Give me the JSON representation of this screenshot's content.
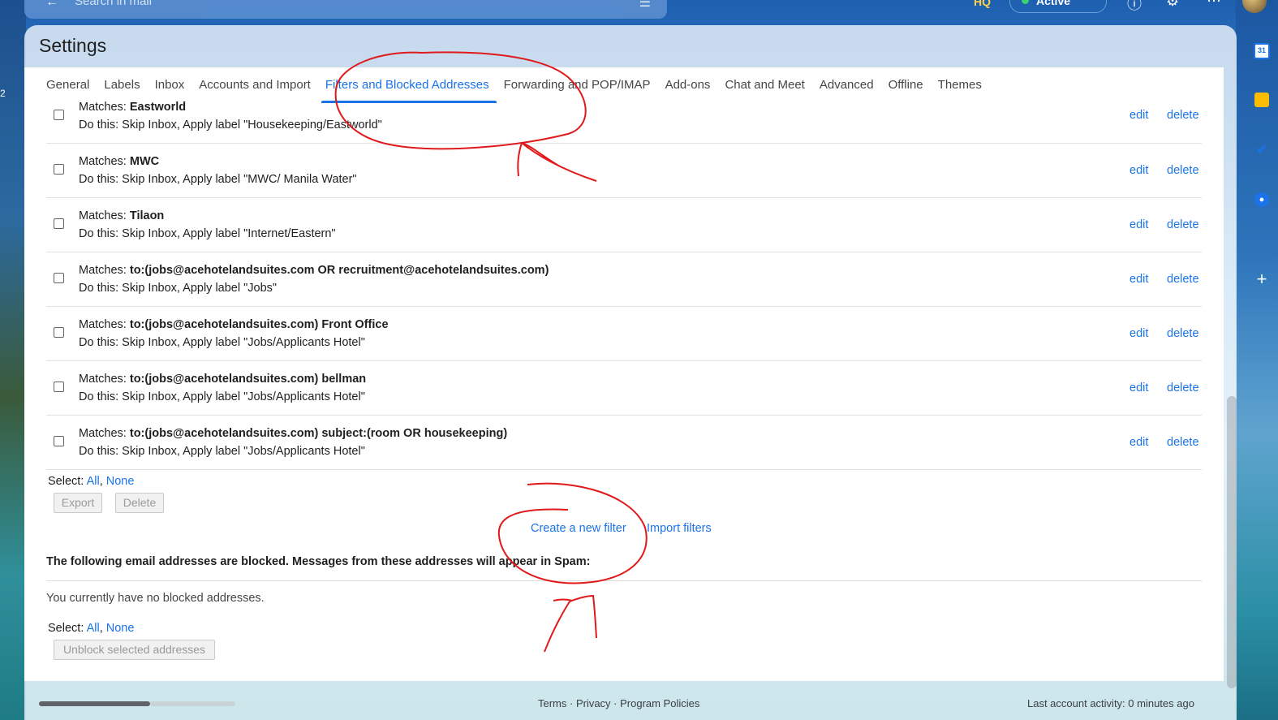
{
  "search": {
    "placeholder": "Search in mail"
  },
  "header": {
    "hq": "HQ",
    "status": "Active"
  },
  "page_title": "Settings",
  "tabs": [
    {
      "label": "General"
    },
    {
      "label": "Labels"
    },
    {
      "label": "Inbox"
    },
    {
      "label": "Accounts and Import"
    },
    {
      "label": "Filters and Blocked Addresses"
    },
    {
      "label": "Forwarding and POP/IMAP"
    },
    {
      "label": "Add-ons"
    },
    {
      "label": "Chat and Meet"
    },
    {
      "label": "Advanced"
    },
    {
      "label": "Offline"
    },
    {
      "label": "Themes"
    }
  ],
  "filters": [
    {
      "match_prefix": "Matches: ",
      "match": "Eastworld",
      "action": "Do this: Skip Inbox, Apply label \"Housekeeping/Eastworld\""
    },
    {
      "match_prefix": "Matches: ",
      "match": "MWC",
      "action": "Do this: Skip Inbox, Apply label \"MWC/ Manila Water\""
    },
    {
      "match_prefix": "Matches: ",
      "match": "Tilaon",
      "action": "Do this: Skip Inbox, Apply label \"Internet/Eastern\""
    },
    {
      "match_prefix": "Matches: ",
      "match": "to:(jobs@acehotelandsuites.com OR recruitment@acehotelandsuites.com)",
      "action": "Do this: Skip Inbox, Apply label \"Jobs\""
    },
    {
      "match_prefix": "Matches: ",
      "match": "to:(jobs@acehotelandsuites.com) Front Office",
      "action": "Do this: Skip Inbox, Apply label \"Jobs/Applicants Hotel\""
    },
    {
      "match_prefix": "Matches: ",
      "match": "to:(jobs@acehotelandsuites.com) bellman",
      "action": "Do this: Skip Inbox, Apply label \"Jobs/Applicants Hotel\""
    },
    {
      "match_prefix": "Matches: ",
      "match": "to:(jobs@acehotelandsuites.com) subject:(room OR housekeeping)",
      "action": "Do this: Skip Inbox, Apply label \"Jobs/Applicants Hotel\""
    }
  ],
  "row_actions": {
    "edit": "edit",
    "delete": "delete"
  },
  "select": {
    "label": "Select:",
    "all": "All",
    "sep": ", ",
    "none": "None"
  },
  "buttons": {
    "export": "Export",
    "delete": "Delete",
    "unblock": "Unblock selected addresses"
  },
  "links": {
    "create_filter": "Create a new filter",
    "import_filters": "Import filters"
  },
  "blocked": {
    "heading": "The following email addresses are blocked. Messages from these addresses will appear in Spam:",
    "empty": "You currently have no blocked addresses."
  },
  "footer": {
    "links": "Terms · Privacy · Program Policies",
    "activity": "Last account activity: 0 minutes ago"
  },
  "rail": {
    "calendar_day": "31"
  },
  "colors": {
    "accent": "#1a73e8",
    "annotation": "#e0191b"
  },
  "icons": [
    "back-arrow-icon",
    "tune-icon",
    "help-icon",
    "gear-icon",
    "apps-grid-icon",
    "calendar-icon",
    "keep-icon",
    "tasks-icon",
    "contacts-icon",
    "plus-icon"
  ]
}
